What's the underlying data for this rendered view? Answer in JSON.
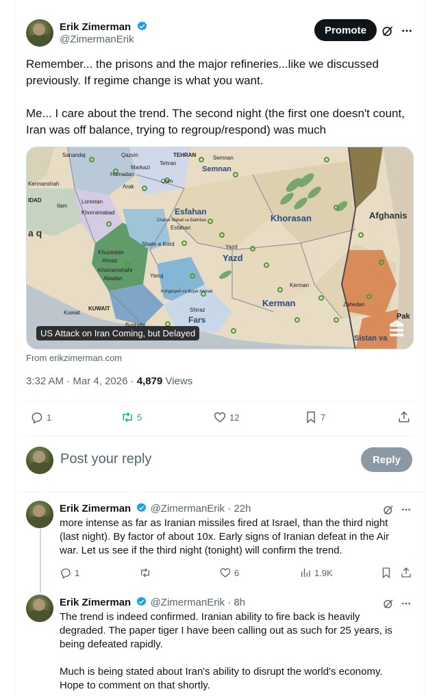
{
  "tweet": {
    "author_name": "Erik Zimerman",
    "author_handle": "@ZimermanErik",
    "promote_label": "Promote",
    "text_p1": "Remember... the prisons and the major refineries...like we discussed previously. If regime change is what you want.",
    "text_p2": "Me... I care about the trend. The second night (the  first one doesn't count, Iran was off balance, trying to regroup/respond) was much",
    "card_caption": "US Attack on Iran Coming, but Delayed",
    "card_source": "From erikzimerman.com",
    "timestamp": "3:32 AM · Mar 4, 2026 · ",
    "views_count": "4,879",
    "views_label": " Views",
    "replies": "1",
    "reposts": "5",
    "likes": "12",
    "bookmarks": "7",
    "repost_color": "#00ba7c"
  },
  "map_labels": {
    "tehran": "TEHRAN",
    "semnan": "Semnan",
    "esfahan": "Esfahan",
    "khorasan": "Khorasan",
    "afghanistan": "Afghanis",
    "yazd": "Yazd",
    "kerman": "Kerman",
    "kerman_city": "Kerman",
    "fars": "Fars",
    "kuwait": "KUWAIT",
    "iraq": "a q",
    "kermanshah": "Kermanshah",
    "lorestan": "Lorestan",
    "khorramabad": "Khorramabad",
    "arak": "Arak",
    "qom": "Qom",
    "hamadan": "Hamadan",
    "sanandaj": "Sanandaj",
    "ilam": "Ilam",
    "dad": "IDAD",
    "ahvaz": "Ahvaz",
    "khuzestan": "Khuzestan",
    "yasuj": "Yasuj",
    "shiraz": "Shiraz",
    "bushehr": "Bushehr",
    "zahedan": "Zahedan",
    "sistan": "Sistan va",
    "pak": "Pak",
    "shahrekord": "Shahr-e Kord",
    "kuwait_city": "Kuwait",
    "chahar": "Chahar Mahall va Bakhtiari",
    "kohgiluyeh": "Kohgiluyeh va Buyer Ahmad",
    "khorramshahr": "Khorramshahr",
    "abadan": "Abadan",
    "yazd_city": "Yazd",
    "semnan_city": "Semnan",
    "esfahan_city": "Esfahan",
    "markazi": "Markazi",
    "tehran_prov": "Tehran",
    "qazvin": "Qazvin"
  },
  "reply_box": {
    "placeholder": "Post your reply",
    "button_label": "Reply"
  },
  "replies": [
    {
      "name": "Erik Zimerman",
      "handle_time": "@ZimermanErik · 22h",
      "text": "more intense as far as Iranian missiles fired at Israel, than the third night (last night). By  factor of about 10x. Early signs of Iranian defeat in the Air war. Let us see if the third night (tonight) will  confirm the trend.",
      "replies": "1",
      "likes": "6",
      "views": "1.9K"
    },
    {
      "name": "Erik Zimerman",
      "handle_time": "@ZimermanErik · 8h",
      "text_p1": "The trend is indeed confirmed. Iranian ability to fire back is heavily degraded. The paper tiger I have been calling out as such for 25 years, is being defeated rapidly.",
      "text_p2": "Much is being stated about Iran's ability to disrupt the world's economy. Hope to comment on that shortly."
    }
  ],
  "icons": [
    "verified-badge-icon",
    "grok-icon",
    "more-icon",
    "reply-icon",
    "repost-icon",
    "like-icon",
    "bookmark-icon",
    "share-icon",
    "views-icon",
    "article-icon"
  ]
}
